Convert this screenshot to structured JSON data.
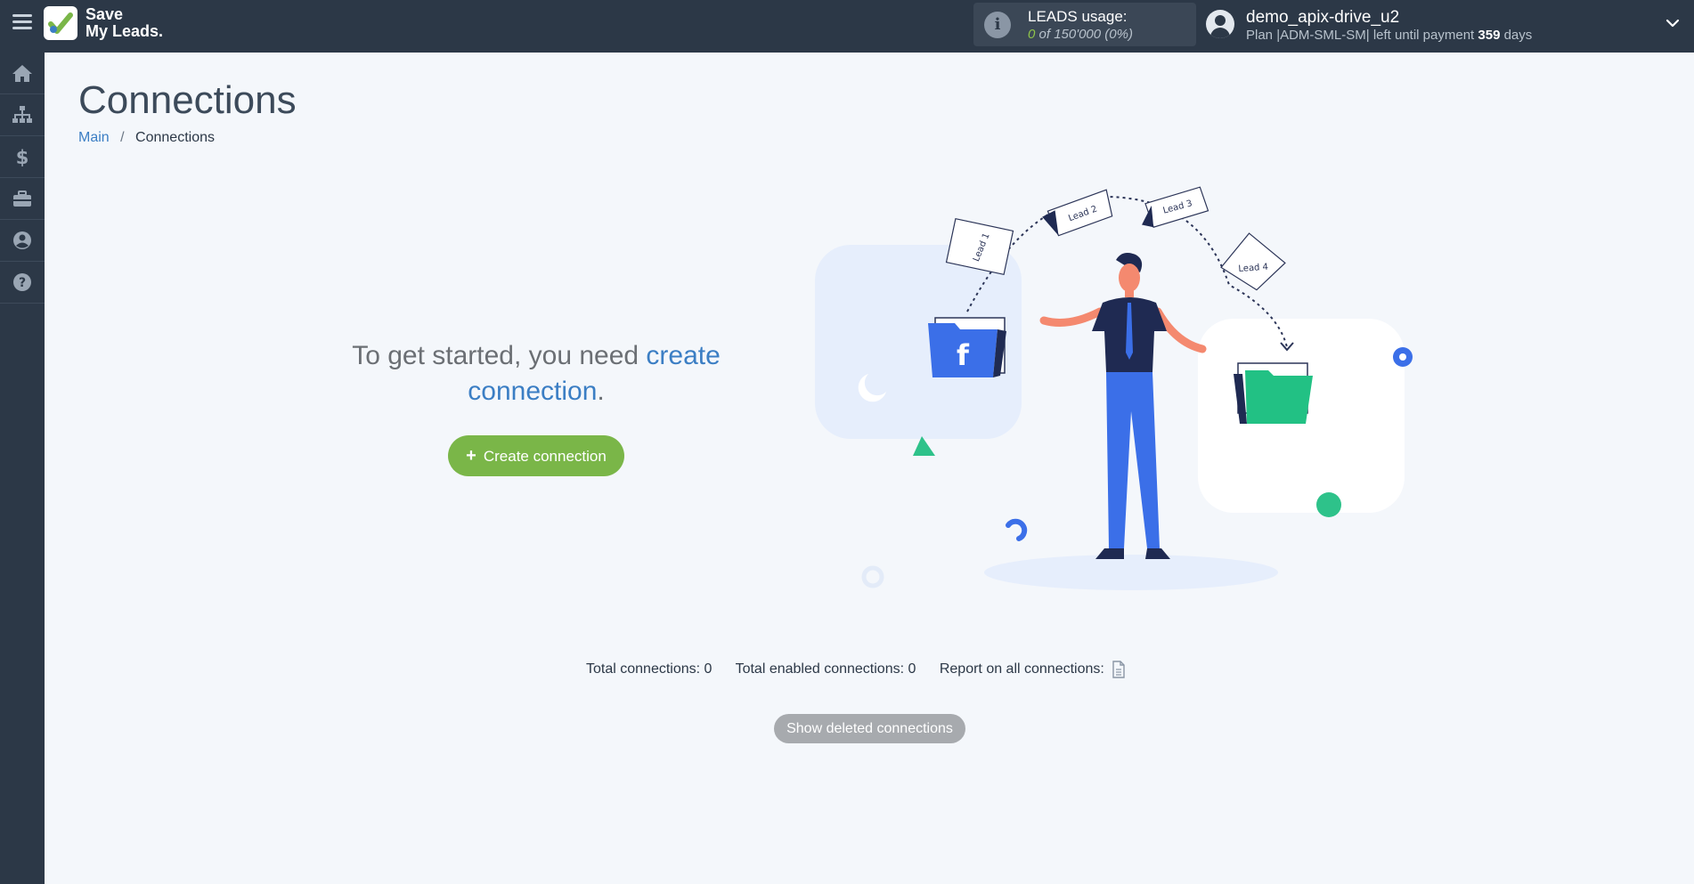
{
  "brand": {
    "line1": "Save",
    "line2": "My Leads.",
    "accent_color": "#7ab648",
    "link_color": "#3b7ec4"
  },
  "header": {
    "menu_icon": "hamburger-icon",
    "leads_usage_label": "LEADS usage:",
    "leads_used": "0",
    "leads_of": "of",
    "leads_total": "150'000",
    "leads_percent": "(0%)",
    "username": "demo_apix-drive_u2",
    "plan_prefix": "Plan |ADM-SML-SM| left until payment",
    "plan_days": "359",
    "plan_suffix": "days"
  },
  "sidebar": {
    "items": [
      {
        "icon": "home-icon"
      },
      {
        "icon": "sitemap-icon"
      },
      {
        "icon": "dollar-icon"
      },
      {
        "icon": "briefcase-icon"
      },
      {
        "icon": "user-circle-icon"
      },
      {
        "icon": "question-circle-icon"
      }
    ]
  },
  "main": {
    "title": "Connections",
    "breadcrumb": {
      "home": "Main",
      "separator": "/",
      "current": "Connections"
    },
    "prompt_text": "To get started, you need",
    "prompt_link": "create connection",
    "prompt_end": ".",
    "create_button": "Create connection",
    "create_button_icon": "+",
    "illustration": {
      "lead_labels": [
        "Lead 1",
        "Lead 2",
        "Lead 3",
        "Lead 4"
      ],
      "source_icon": "facebook-folder-icon",
      "destination_icon": "green-folder-icon"
    },
    "stats": {
      "total": "Total connections: 0",
      "enabled": "Total enabled connections: 0",
      "report": "Report on all connections:"
    },
    "show_deleted_button": "Show deleted connections"
  }
}
